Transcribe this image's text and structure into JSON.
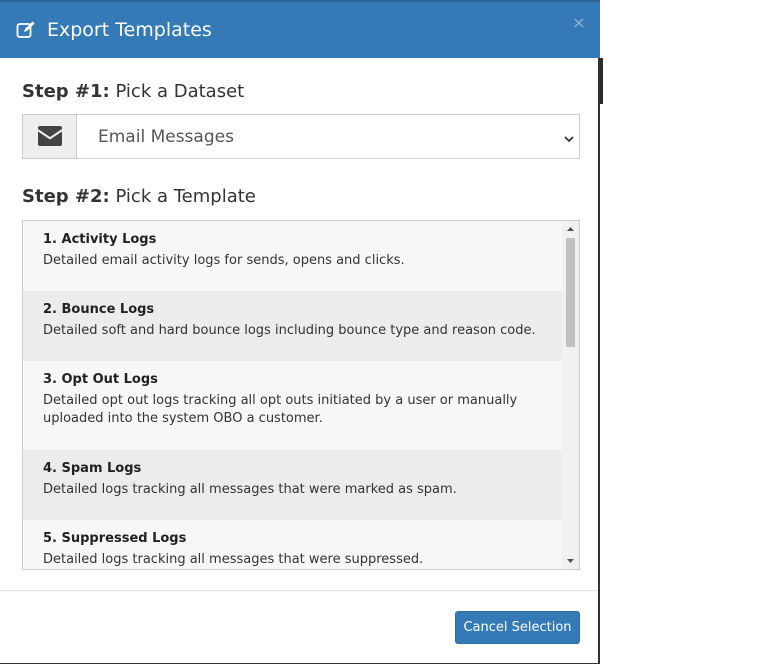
{
  "modal": {
    "title": "Export Templates",
    "close_label": "×"
  },
  "step1": {
    "label": "Step #1:",
    "text": "Pick a Dataset"
  },
  "dataset_select": {
    "icon": "envelope-icon",
    "value": "Email Messages"
  },
  "step2": {
    "label": "Step #2:",
    "text": "Pick a Template"
  },
  "templates": [
    {
      "title": "1. Activity Logs",
      "description": "Detailed email activity logs for sends, opens and clicks."
    },
    {
      "title": "2. Bounce Logs",
      "description": "Detailed soft and hard bounce logs including bounce type and reason code."
    },
    {
      "title": "3. Opt Out Logs",
      "description": "Detailed opt out logs tracking all opt outs initiated by a user or manually uploaded into the system OBO a customer."
    },
    {
      "title": "4. Spam Logs",
      "description": "Detailed logs tracking all messages that were marked as spam."
    },
    {
      "title": "5. Suppressed Logs",
      "description": "Detailed logs tracking all messages that were suppressed."
    }
  ],
  "footer": {
    "cancel_label": "Cancel Selection"
  },
  "colors": {
    "header_bg": "#337ab7",
    "button_bg": "#337ab7",
    "row_light": "#f7f7f7",
    "row_dark": "#ececec"
  }
}
